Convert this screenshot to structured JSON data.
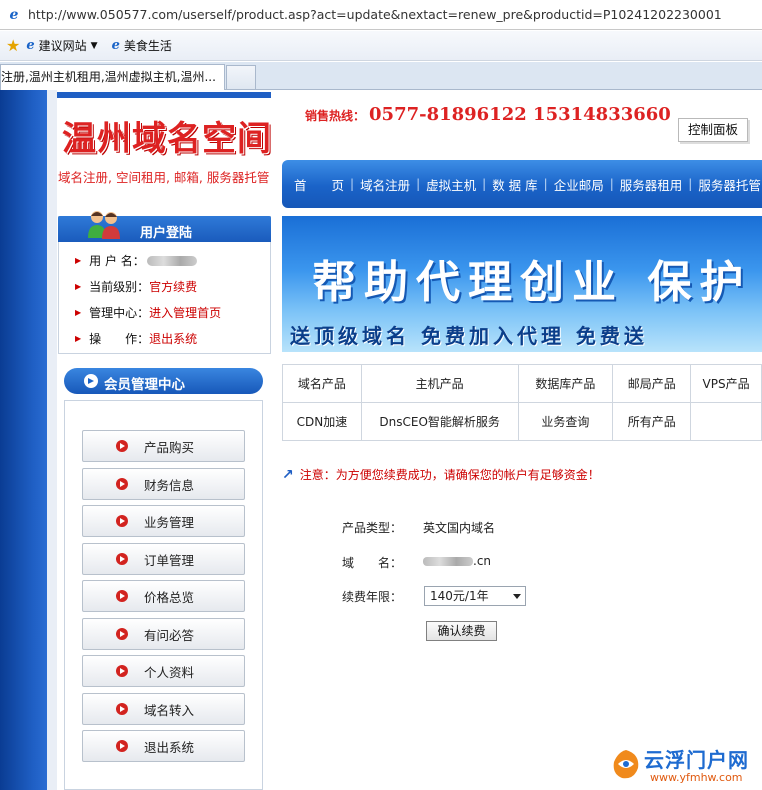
{
  "browser": {
    "url": "http://www.050577.com/userself/product.asp?act=update&nextact=renew_pre&productid=P10241202230001",
    "favorites": [
      {
        "label": "建议网站",
        "has_dropdown": true
      },
      {
        "label": "美食生活",
        "has_dropdown": false
      }
    ],
    "tab_title": "注册,温州主机租用,温州虚拟主机,温州..."
  },
  "site": {
    "logo_text": "温州域名空间",
    "logo_sub": "域名注册, 空间租用, 邮箱, 服务器托管",
    "hotline_label": "销售热线：",
    "hotline_numbers": "0577-81896122 15314833660",
    "control_panel": "控制面板",
    "nav": [
      "首　　页",
      "域名注册",
      "虚拟主机",
      "数 据 库",
      "企业邮局",
      "服务器租用",
      "服务器托管"
    ],
    "banner_main": "帮助代理创业 保护",
    "banner_sub": "送顶级域名 免费加入代理 免费送"
  },
  "products": {
    "row1": [
      "域名产品",
      "主机产品",
      "数据库产品",
      "邮局产品",
      "VPS产品"
    ],
    "row2": [
      "CDN加速",
      "DnsCEO智能解析服务",
      "业务查询",
      "所有产品",
      ""
    ]
  },
  "login": {
    "title": "用户登陆",
    "rows": [
      {
        "label": "用 户 名：",
        "value": ""
      },
      {
        "label": "当前级别：",
        "value": "官方续费"
      },
      {
        "label": "管理中心：",
        "value": "进入管理首页"
      },
      {
        "label": "操　　作：",
        "value": "退出系统"
      }
    ]
  },
  "member": {
    "title": "会员管理中心",
    "items": [
      "产品购买",
      "财务信息",
      "业务管理",
      "订单管理",
      "价格总览",
      "有问必答",
      "个人资料",
      "域名转入",
      "退出系统"
    ]
  },
  "form": {
    "notice": "注意：为方便您续费成功，请确保您的帐户有足够资金！",
    "type_label": "产品类型：",
    "type_value": "英文国内域名",
    "domain_label": "域　　名：",
    "domain_suffix": ".cn",
    "period_label": "续费年限：",
    "period_value": "140元/1年",
    "submit": "确认续费"
  },
  "watermark": {
    "title": "云浮门户网",
    "url": "www.yfmhw.com"
  },
  "colors": {
    "brand_blue": "#1a63c8",
    "accent_red": "#dd2222"
  }
}
